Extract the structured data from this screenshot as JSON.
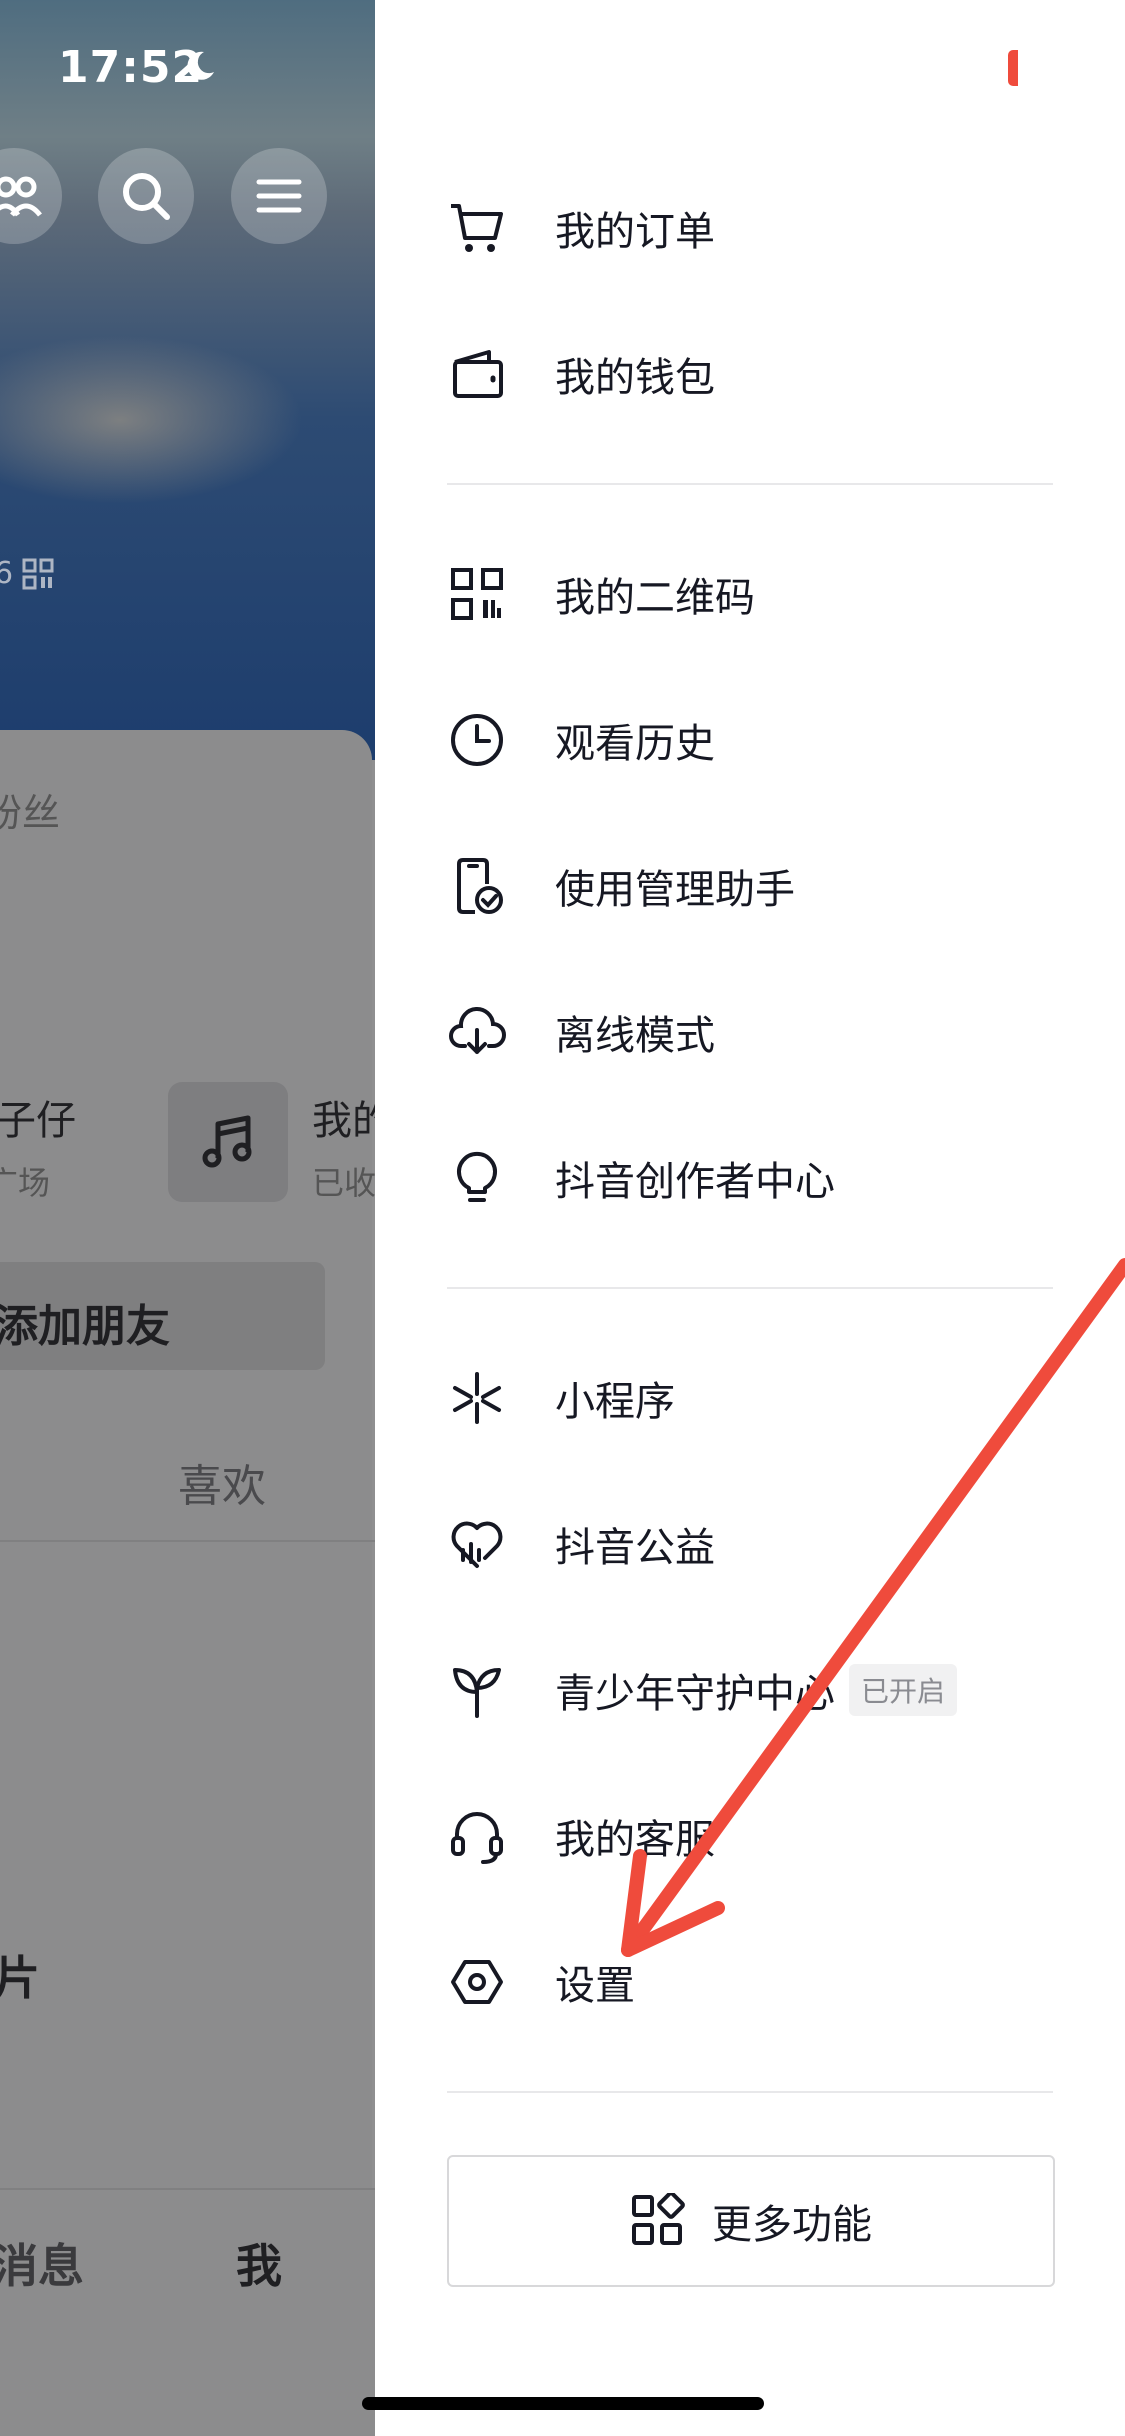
{
  "status_bar": {
    "time": "17:52"
  },
  "profile_background": {
    "id_fragment": "6",
    "fans_label_fragment": "粉丝",
    "item1_title": "子仔",
    "item1_sub": "广场",
    "item2_title": "我的",
    "item2_sub": "已收",
    "add_friends_label": "添加朋友",
    "likes_tab": "喜欢",
    "photo_fragment": "片",
    "nav_messages": "消息",
    "nav_me": "我"
  },
  "drawer": {
    "group1": [
      {
        "label": "我的订单",
        "icon": "cart-icon"
      },
      {
        "label": "我的钱包",
        "icon": "wallet-icon"
      }
    ],
    "group2": [
      {
        "label": "我的二维码",
        "icon": "qrcode-icon"
      },
      {
        "label": "观看历史",
        "icon": "clock-icon"
      },
      {
        "label": "使用管理助手",
        "icon": "phone-check-icon"
      },
      {
        "label": "离线模式",
        "icon": "cloud-download-icon"
      },
      {
        "label": "抖音创作者中心",
        "icon": "lightbulb-icon"
      }
    ],
    "group3": [
      {
        "label": "小程序",
        "icon": "mini-program-icon"
      },
      {
        "label": "抖音公益",
        "icon": "heart-charity-icon"
      },
      {
        "label": "青少年守护中心",
        "icon": "sprout-icon",
        "tag": "已开启"
      },
      {
        "label": "我的客服",
        "icon": "headset-icon"
      },
      {
        "label": "设置",
        "icon": "settings-hexagon-icon"
      }
    ],
    "more_button": {
      "label": "更多功能",
      "icon": "apps-icon"
    }
  },
  "colors": {
    "annotation_arrow": "#ef4b3c",
    "text": "#161823",
    "divider": "#e8e8ea"
  }
}
